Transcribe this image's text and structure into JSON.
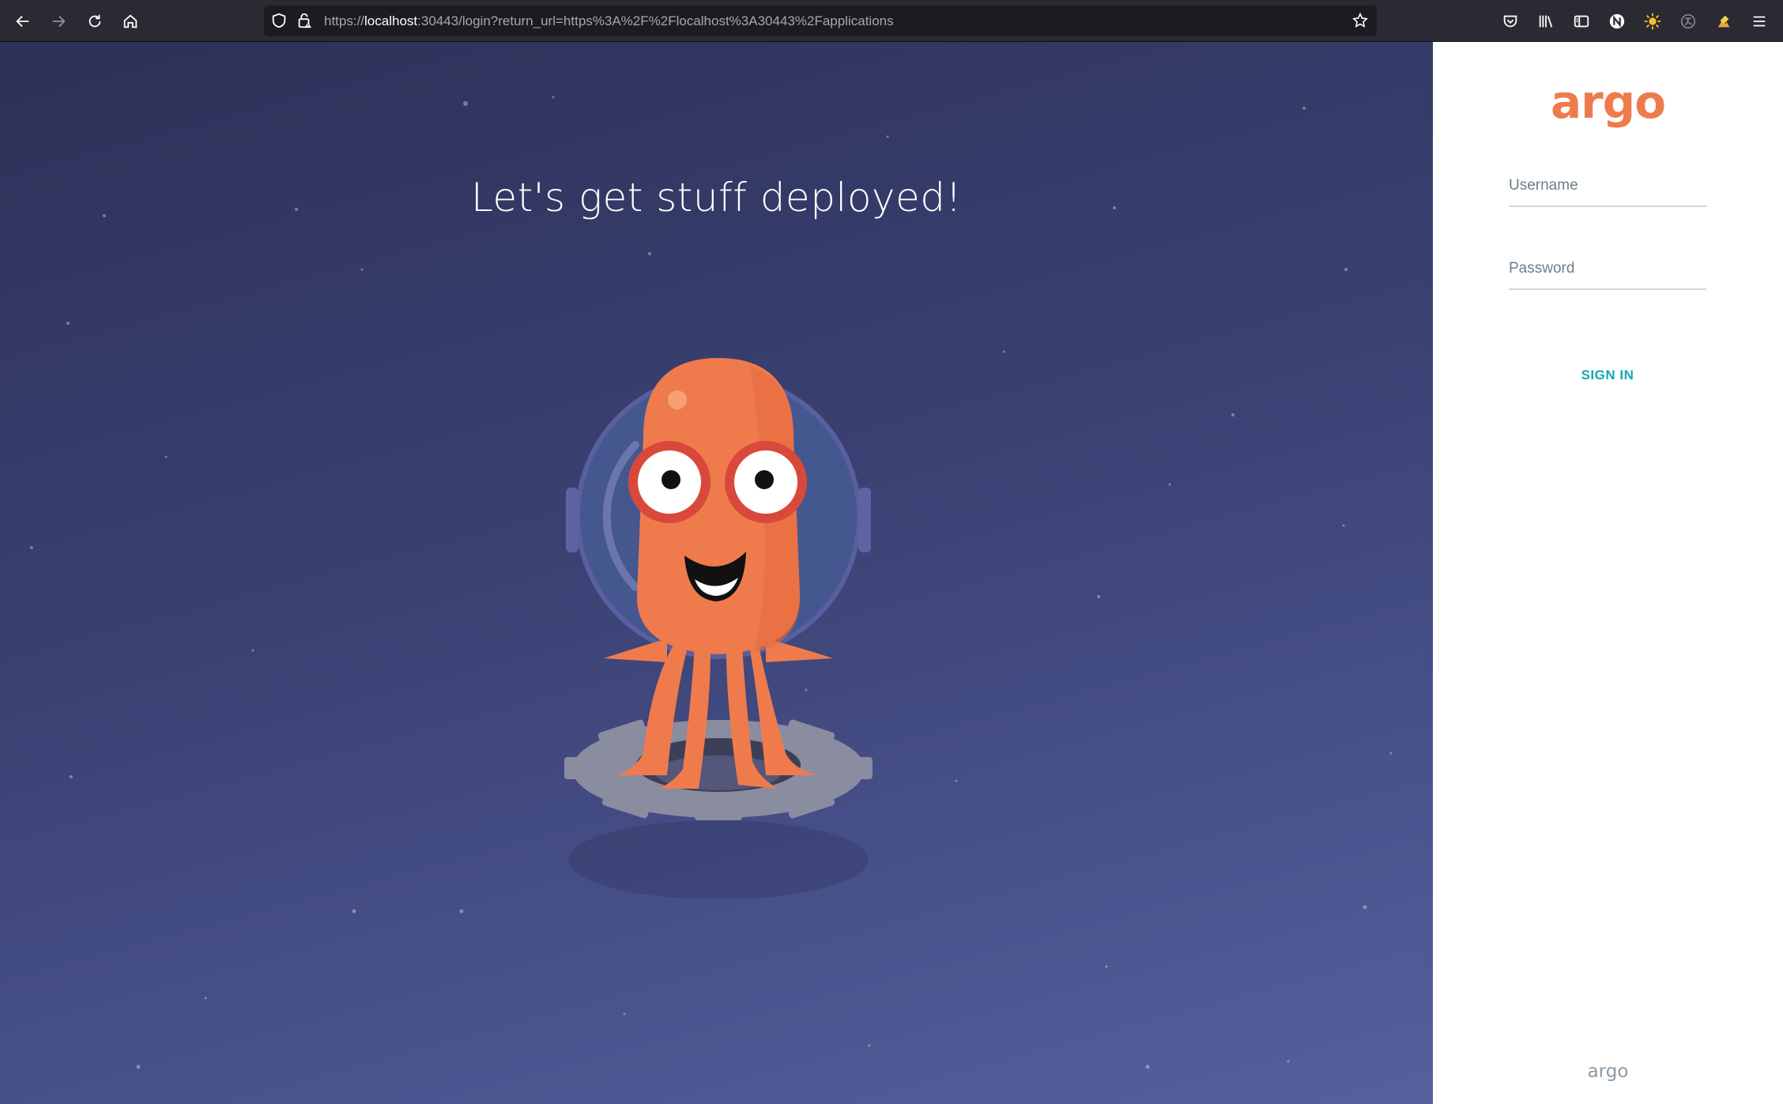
{
  "browser": {
    "url_prefix": "https://",
    "url_host": "localhost",
    "url_rest": ":30443/login?return_url=https%3A%2F%2Flocalhost%3A30443%2Fapplications",
    "icons": [
      "back-icon",
      "forward-icon",
      "reload-icon",
      "home-icon",
      "shield-icon",
      "lock-icon",
      "star-icon",
      "pocket-icon",
      "library-icon",
      "sidebar-icon",
      "notion-icon",
      "sun-icon",
      "translate-icon",
      "extension-icon",
      "menu-icon"
    ]
  },
  "hero": {
    "tagline": "Let's get stuff deployed!"
  },
  "login": {
    "logo": "argo",
    "username_placeholder": "Username",
    "password_placeholder": "Password",
    "signin_label": "SIGN IN",
    "footer_logo": "argo"
  },
  "colors": {
    "accent": "#18a5b5",
    "brand": "#ef7b4d",
    "mascot": "#ef7b4d",
    "space": "#3a4172"
  }
}
